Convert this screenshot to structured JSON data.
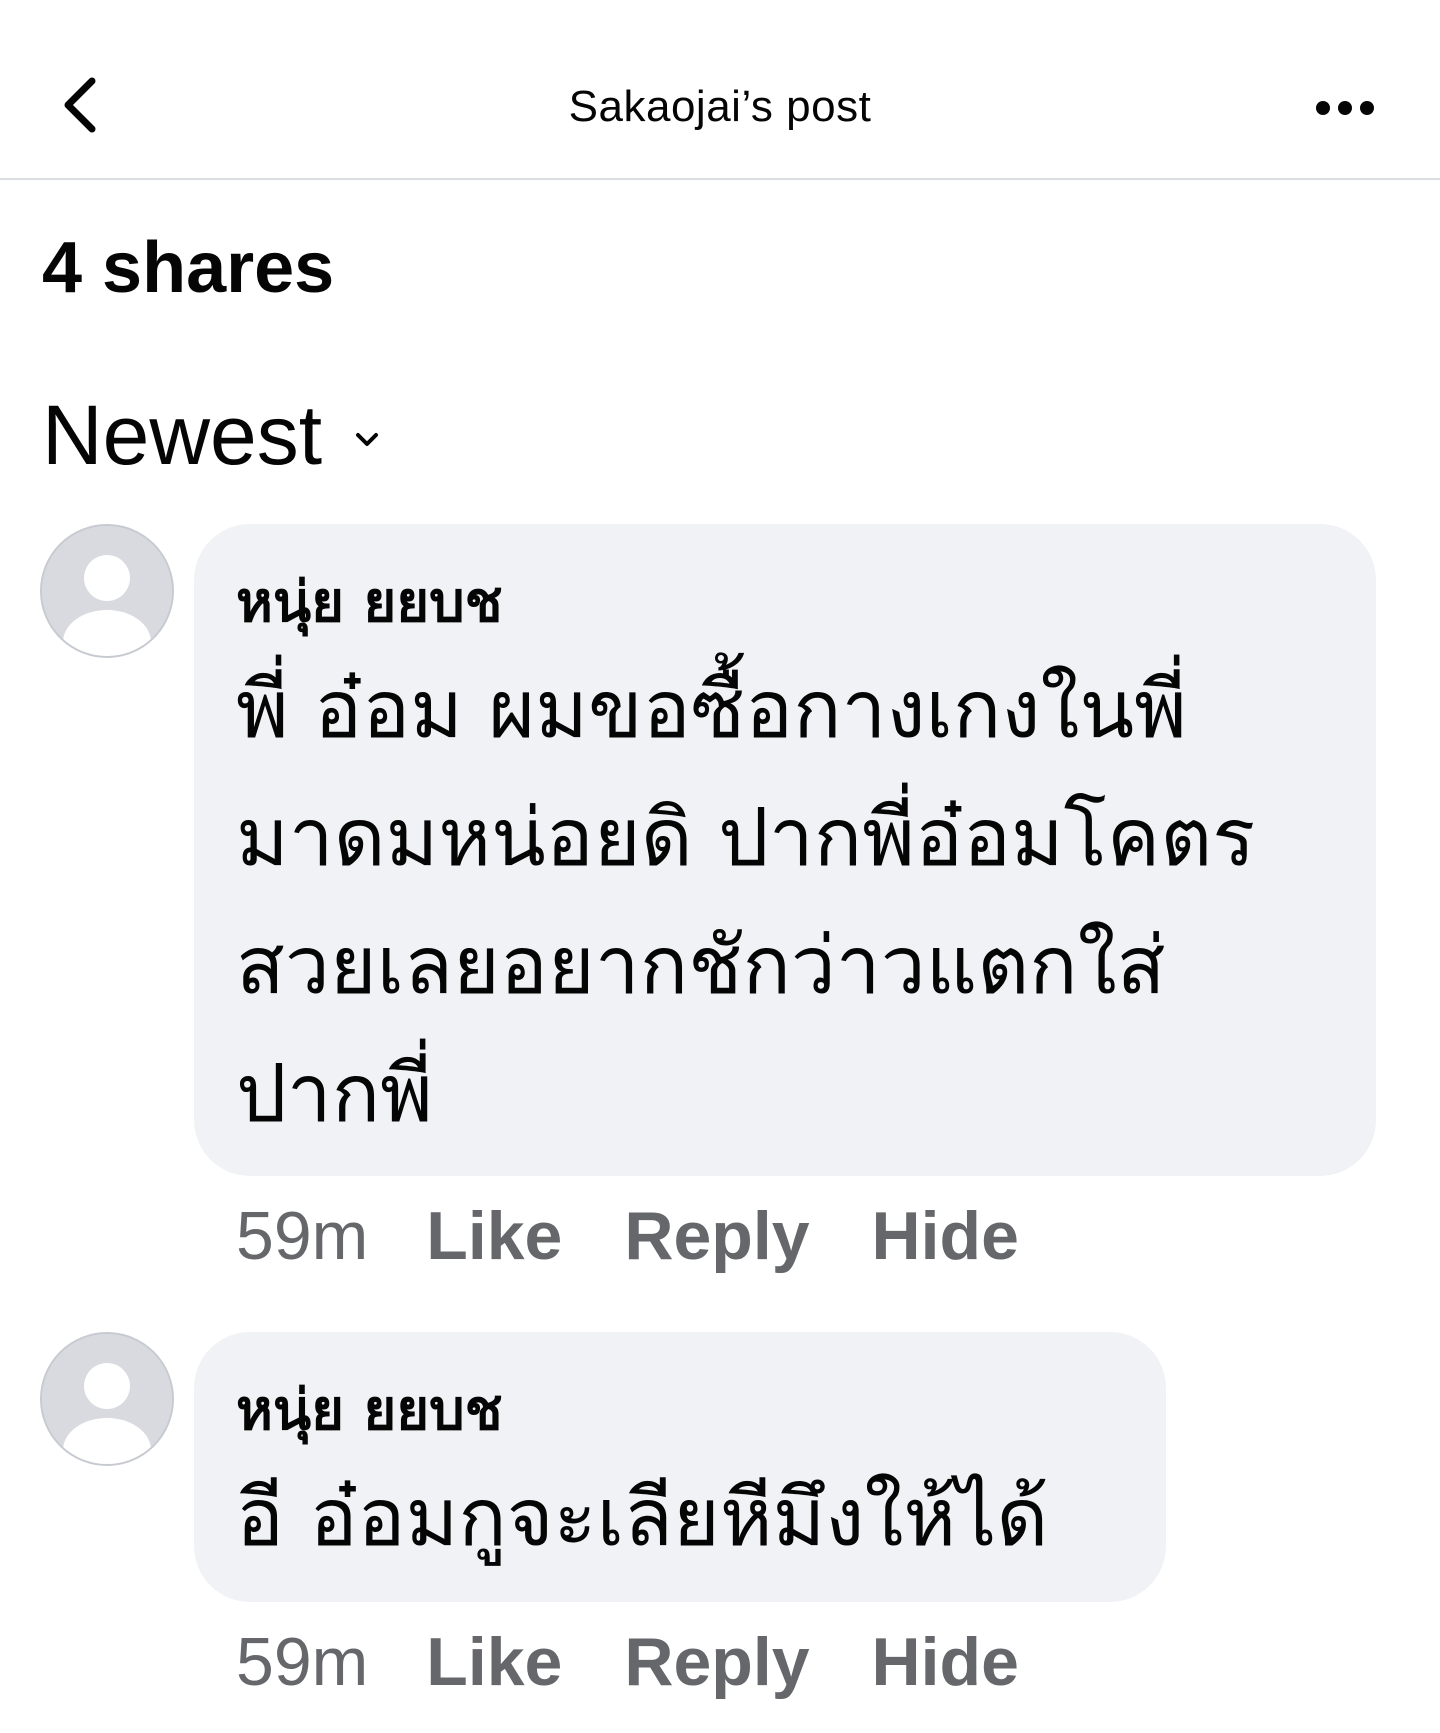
{
  "header": {
    "title": "Sakaojai’s post",
    "back_icon": "chevron-left-icon",
    "more_icon": "more-horizontal-icon"
  },
  "shares": {
    "label": "4 shares"
  },
  "sort": {
    "label": "Newest",
    "icon": "chevron-down-icon"
  },
  "comments": [
    {
      "author": "หนุ่ย ยยบช",
      "lines": [
        "พี่  อ๋อม ผมขอซื้อกางเกงในพี่",
        "มาดมหน่อยดิ ปากพี่อ๋อมโคตร",
        "สวยเลยอยากชักว่าวแตกใส่",
        "ปากพี่"
      ],
      "time": "59m",
      "like": "Like",
      "reply": "Reply",
      "hide": "Hide"
    },
    {
      "author": "หนุ่ย ยยบช",
      "lines": [
        "อี  อ๋อมกูจะเลียหีมึงให้ได้"
      ],
      "time": "59m",
      "like": "Like",
      "reply": "Reply",
      "hide": "Hide"
    }
  ],
  "colors": {
    "bubble": "#f0f2f5",
    "secondary_text": "#65676b",
    "divider": "#dadde1"
  }
}
